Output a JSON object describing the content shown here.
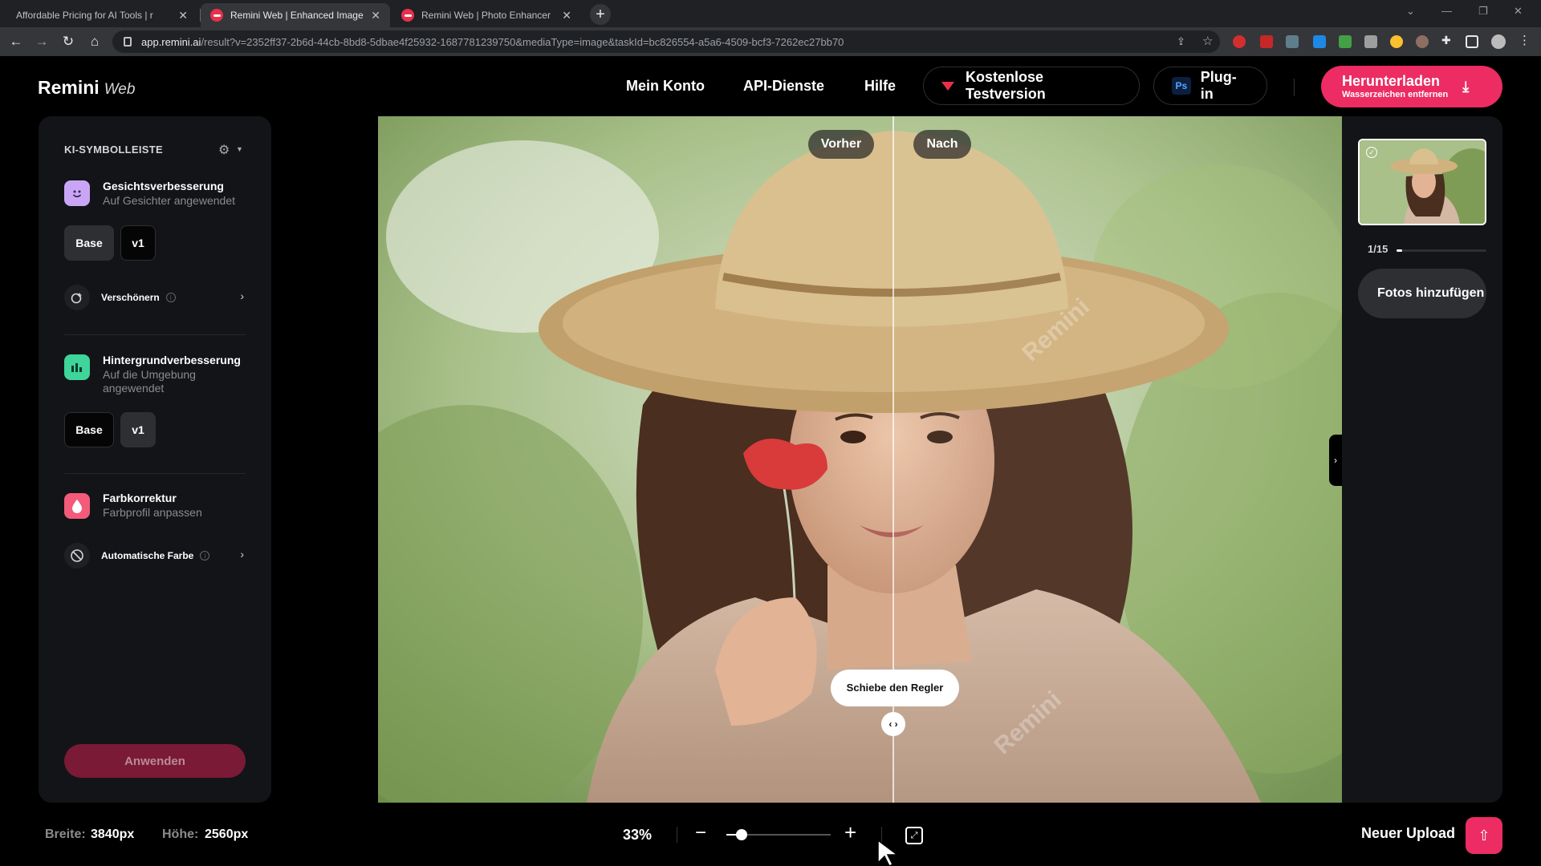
{
  "browser": {
    "tabs": [
      {
        "title": "Affordable Pricing for AI Tools | r",
        "active": false
      },
      {
        "title": "Remini Web | Enhanced Image",
        "active": true
      },
      {
        "title": "Remini Web | Photo Enhancer",
        "active": false
      }
    ],
    "url_host": "app.remini.ai",
    "url_rest": "/result?v=2352ff37-2b6d-44cb-8bd8-5dbae4f25932-1687781239750&mediaType=image&taskId=bc826554-a5a6-4509-bcf3-7262ec27bb70"
  },
  "header": {
    "brand": "Remini",
    "brand_sub": "Web",
    "nav": [
      "Mein Konto",
      "API-Dienste",
      "Hilfe"
    ],
    "trial_label": "Kostenlose Testversion",
    "plugin_label": "Plug-in",
    "plugin_icon": "Ps",
    "download_label": "Herunterladen",
    "download_sub": "Wasserzeichen entfernen"
  },
  "sidebar": {
    "title": "KI-SYMBOLLEISTE",
    "face": {
      "title": "Gesichtsverbesserung",
      "subtitle": "Auf Gesichter angewendet",
      "options": [
        "Base",
        "v1"
      ],
      "selected": "Base",
      "sub_label": "Verschönern"
    },
    "background": {
      "title": "Hintergrundverbesserung",
      "subtitle": "Auf die Umgebung angewendet",
      "options": [
        "Base",
        "v1"
      ],
      "selected": "v1"
    },
    "color": {
      "title": "Farbkorrektur",
      "subtitle": "Farbprofil anpassen",
      "sub_label": "Automatische Farbe"
    },
    "apply_label": "Anwenden"
  },
  "viewer": {
    "before_label": "Vorher",
    "after_label": "Nach",
    "slider_tip": "Schiebe den Regler",
    "split_fraction": 0.535,
    "watermark": "Remini"
  },
  "right_panel": {
    "counter": "1/15",
    "progress": 0.0667,
    "add_photos_label": "Fotos hinzufügen"
  },
  "bottom": {
    "width_label": "Breite:",
    "width_value": "3840px",
    "height_label": "Höhe:",
    "height_value": "2560px",
    "zoom": "33%",
    "zoom_fraction": 0.1,
    "new_upload_label": "Neuer Upload"
  },
  "colors": {
    "accent": "#ec2c63",
    "panel": "#131417",
    "face_icon": "#c9a6f5",
    "bg_icon": "#3ed49a",
    "color_icon": "#f45a7a"
  }
}
